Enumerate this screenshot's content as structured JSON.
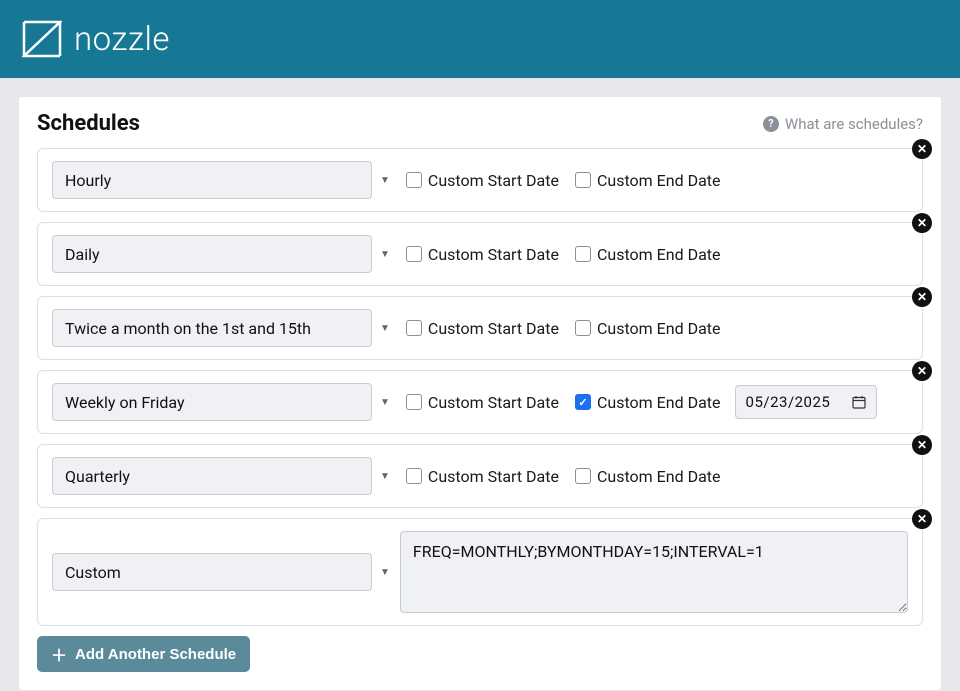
{
  "brand": "nozzle",
  "panel": {
    "title": "Schedules",
    "help_text": "What are schedules?"
  },
  "labels": {
    "custom_start": "Custom Start Date",
    "custom_end": "Custom End Date",
    "add_schedule": "Add Another Schedule"
  },
  "schedules": [
    {
      "name": "Hourly",
      "start_checked": false,
      "end_checked": false
    },
    {
      "name": "Daily",
      "start_checked": false,
      "end_checked": false
    },
    {
      "name": "Twice a month on the 1st and 15th",
      "start_checked": false,
      "end_checked": false
    },
    {
      "name": "Weekly on Friday",
      "start_checked": false,
      "end_checked": true,
      "end_date": "05/23/2025"
    },
    {
      "name": "Quarterly",
      "start_checked": false,
      "end_checked": false
    },
    {
      "name": "Custom",
      "rrule": "FREQ=MONTHLY;BYMONTHDAY=15;INTERVAL=1"
    }
  ]
}
